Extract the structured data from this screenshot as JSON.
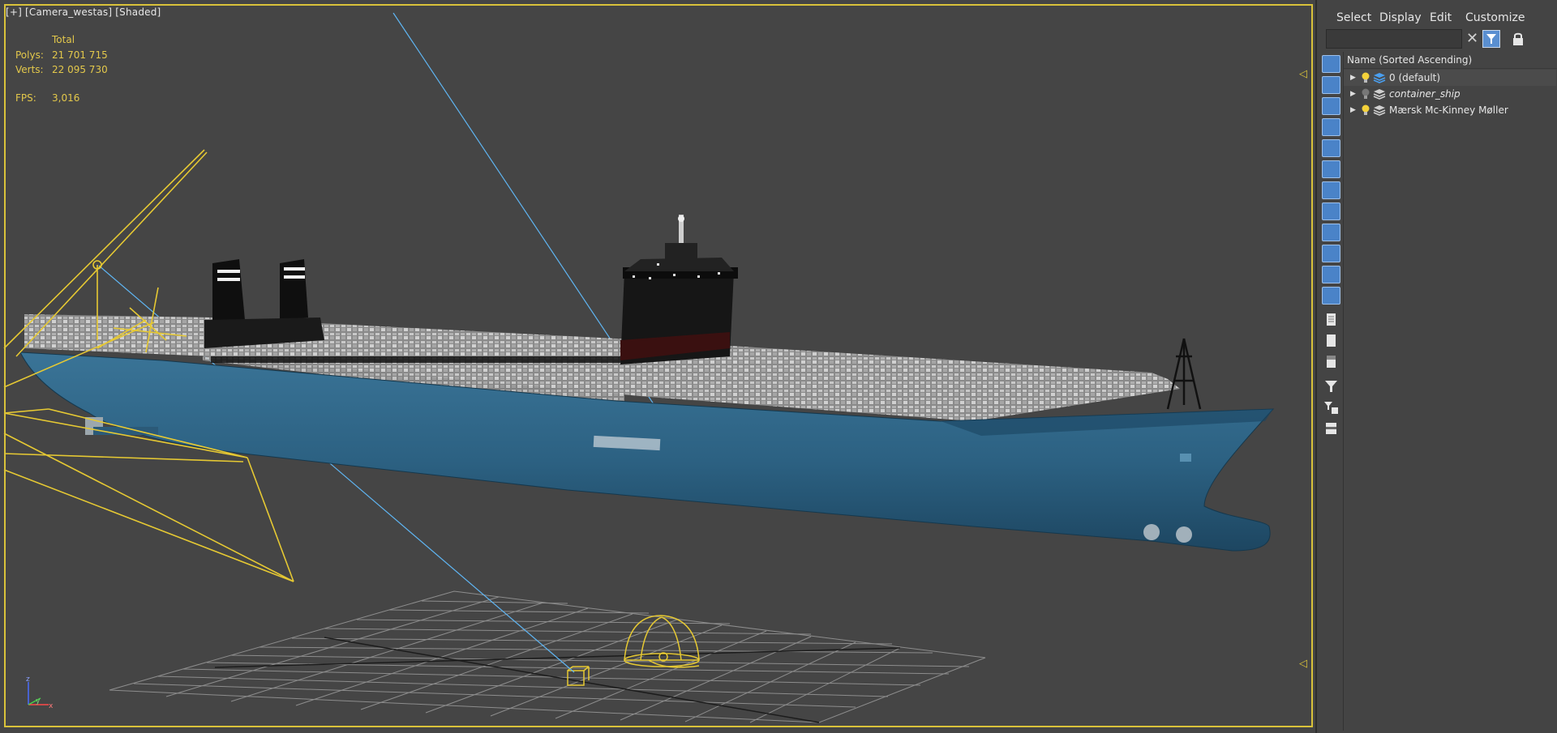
{
  "viewport": {
    "label": "[+] [Camera_westas] [Shaded]",
    "stats": {
      "header": "Total",
      "polys_label": "Polys:",
      "polys_value": "21 701 715",
      "verts_label": "Verts:",
      "verts_value": "22 095 730",
      "fps_label": "FPS:",
      "fps_value": "3,016"
    },
    "axis": {
      "z": "z",
      "y": "y",
      "x": "x"
    }
  },
  "panel": {
    "menu": [
      "Select",
      "Display",
      "Edit",
      "Customize"
    ],
    "search": {
      "value": "",
      "placeholder": ""
    },
    "column_header": "Name (Sorted Ascending)",
    "tree": [
      {
        "label": "0 (default)",
        "bulb": "on",
        "italic": false
      },
      {
        "label": "container_ship",
        "bulb": "off",
        "italic": true
      },
      {
        "label": "Mærsk Mc-Kinney Møller",
        "bulb": "on",
        "italic": false
      }
    ]
  },
  "colors": {
    "hull": "#2f6384",
    "selection": "#d9c23a",
    "stats_text": "#e3c84b",
    "toolbar_blue": "#4a83c8"
  }
}
